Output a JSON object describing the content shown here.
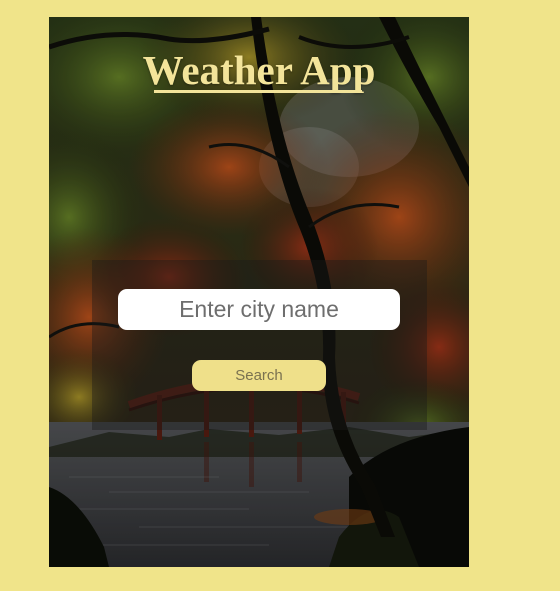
{
  "app": {
    "title": "Weather App"
  },
  "search": {
    "placeholder": "Enter city name",
    "value": "",
    "button_label": "Search"
  },
  "colors": {
    "page_background": "#f0e48a",
    "title": "#f3e49a",
    "button_background": "#efe08a",
    "button_text": "#7a7250",
    "panel_overlay": "rgba(25,25,25,0.40)"
  }
}
